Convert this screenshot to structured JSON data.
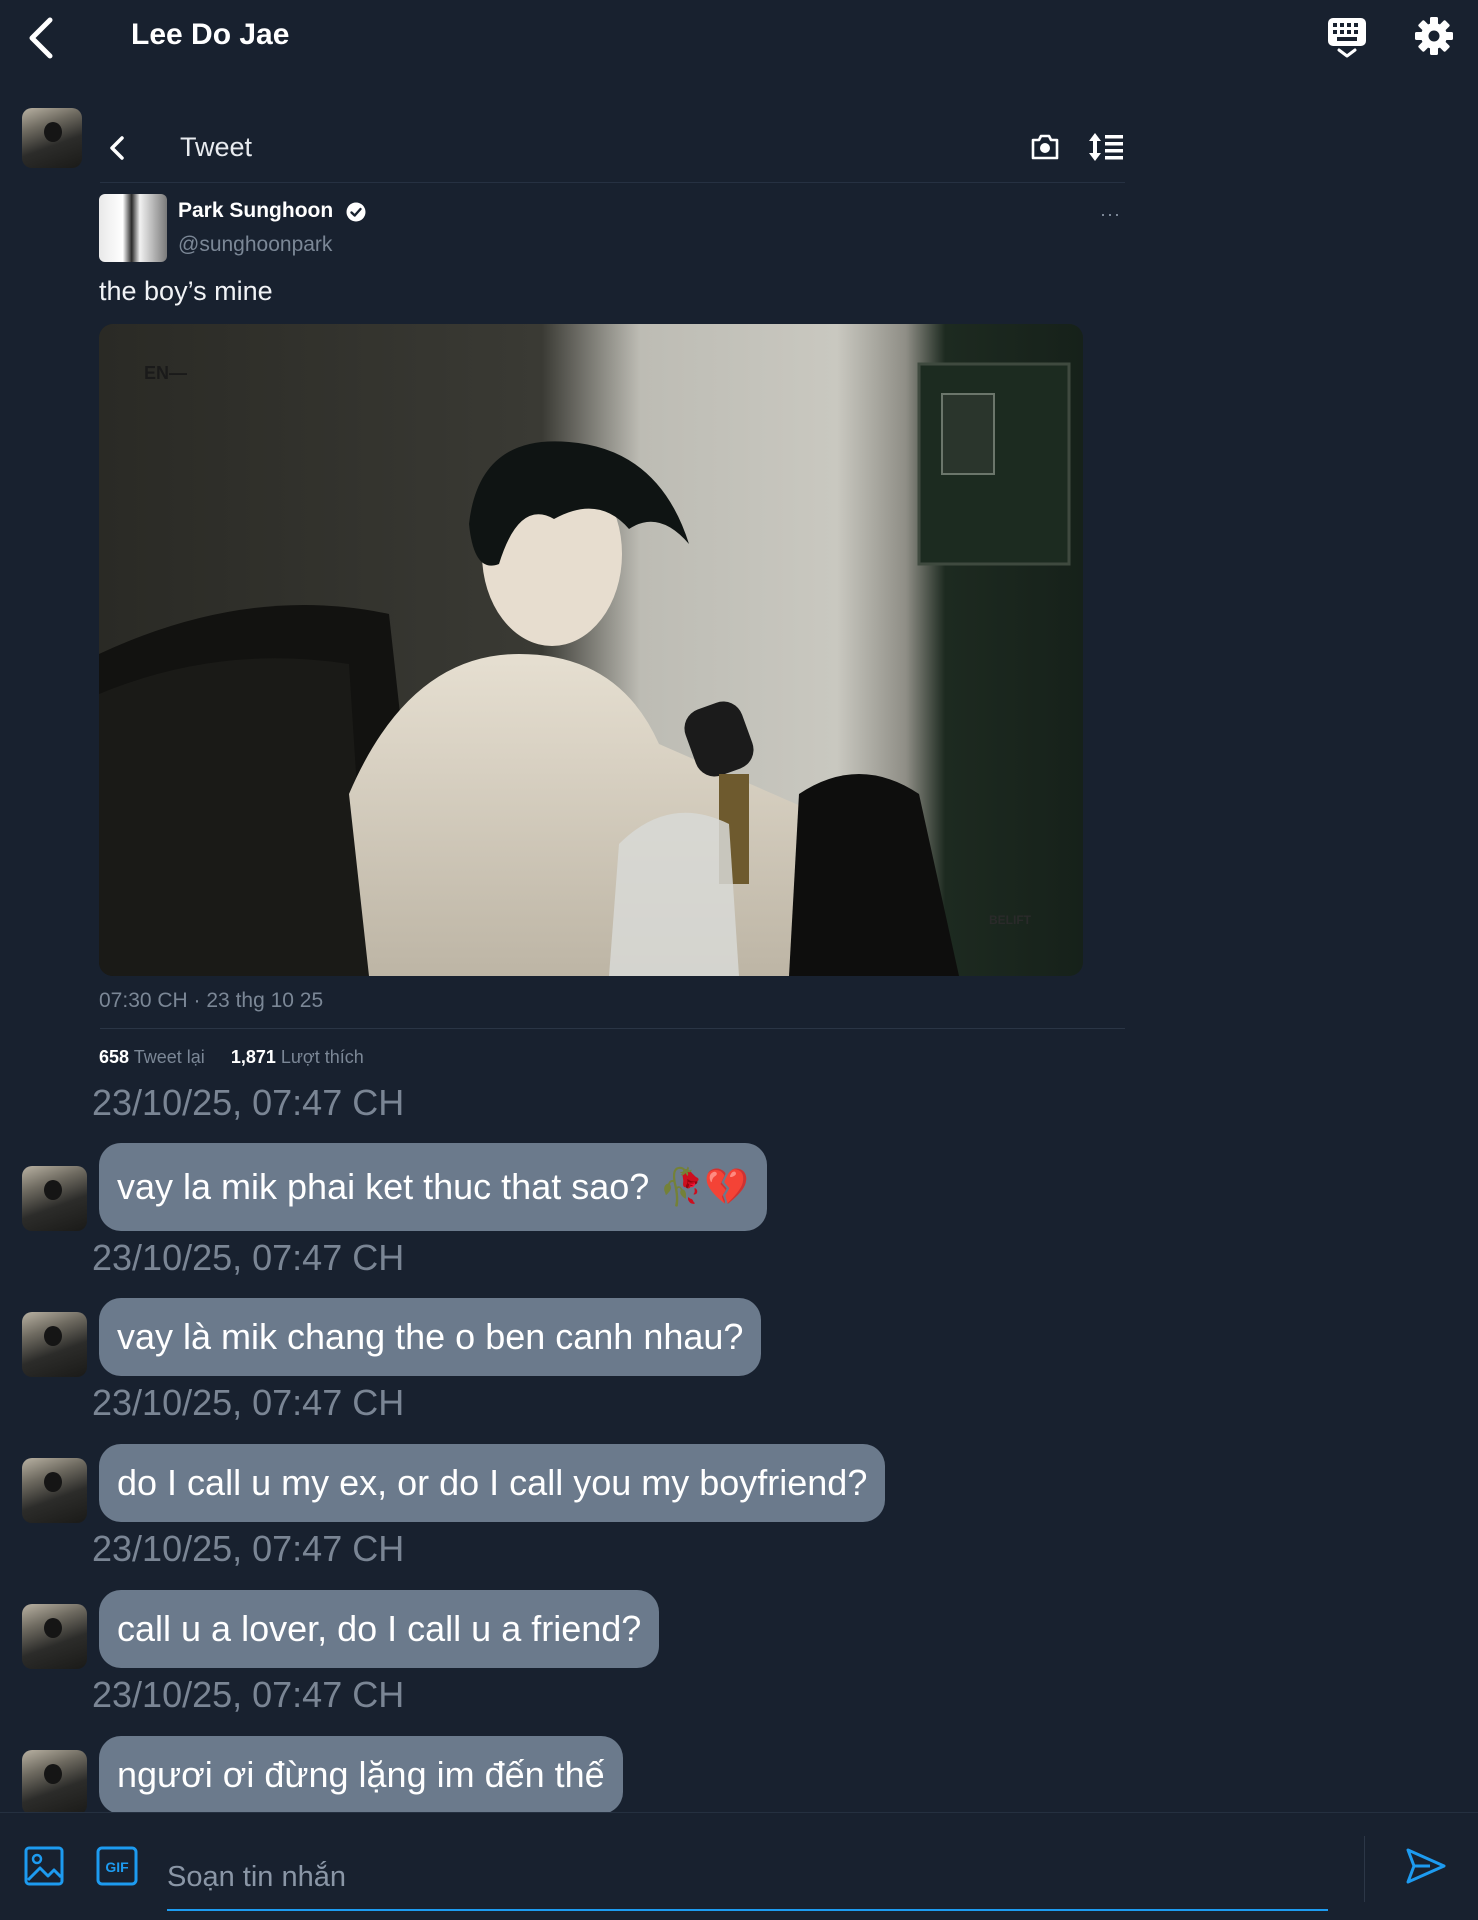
{
  "header": {
    "title": "Lee Do Jae"
  },
  "tweet": {
    "nav_title": "Tweet",
    "author_name": "Park Sunghoon",
    "author_handle": "@sunghoonpark",
    "more": "···",
    "text": "the boy’s mine",
    "photo_watermark": "EN—",
    "photo_logo": "BELIFT",
    "meta": "07:30 CH · 23 thg 10 25",
    "retweet_count": "658",
    "retweet_label": "Tweet lại",
    "like_count": "1,871",
    "like_label": "Lượt thích",
    "shared_timestamp": "23/10/25, 07:47 CH"
  },
  "messages": [
    {
      "text": "vay la mik phai ket thuc that sao? 🥀💔",
      "timestamp": "23/10/25, 07:47 CH"
    },
    {
      "text": "vay là mik chang the o ben canh nhau?",
      "timestamp": "23/10/25, 07:47 CH"
    },
    {
      "text": "do I call u my ex, or do I call you my boyfriend?",
      "timestamp": "23/10/25, 07:47 CH"
    },
    {
      "text": "call u a lover, do I call u a friend?",
      "timestamp": "23/10/25, 07:47 CH"
    },
    {
      "text": "ngươi ơi đừng lặng im đến thế"
    }
  ],
  "composer": {
    "placeholder": "Soạn tin nhắn",
    "gif_label": "GIF"
  },
  "colors": {
    "background": "#18212f",
    "bubble": "#6b7a8c",
    "accent": "#1d9bf0",
    "muted_text": "#7a8594"
  },
  "icons": [
    "back-arrow-icon",
    "keyboard-icon",
    "gear-icon",
    "camera-icon",
    "sort-icon",
    "verified-badge-icon",
    "image-icon",
    "gif-icon",
    "send-icon"
  ]
}
